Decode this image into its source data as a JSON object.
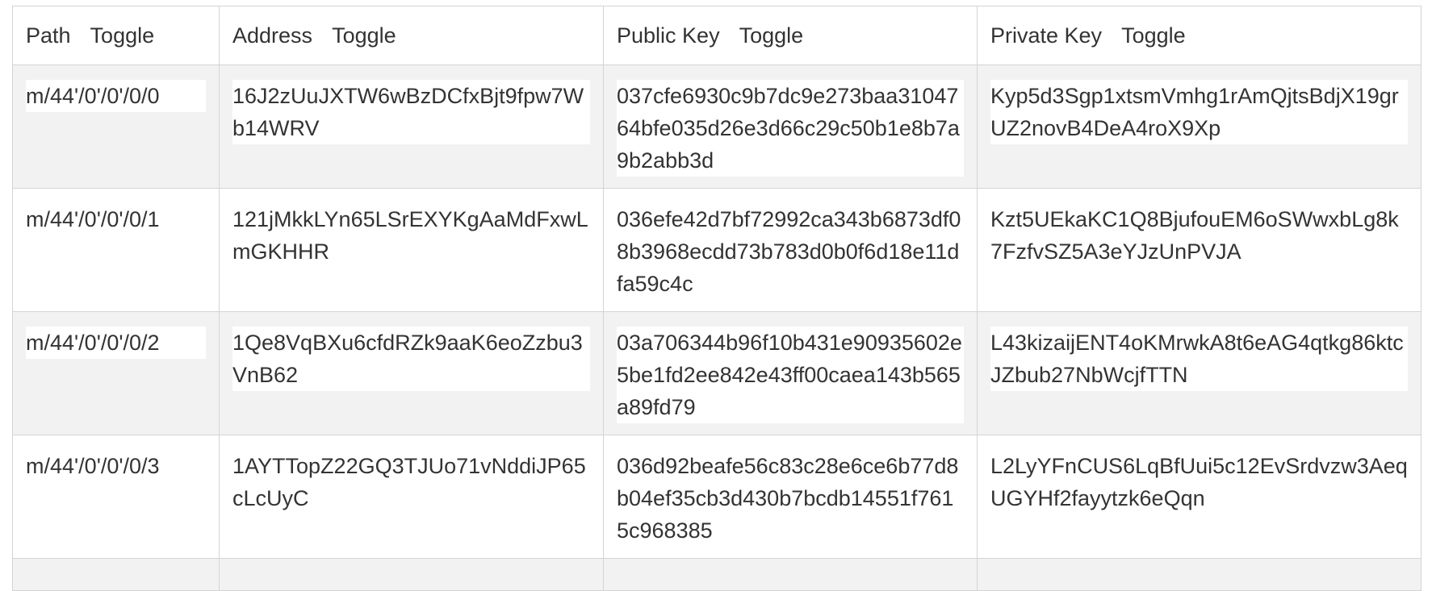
{
  "headers": {
    "path": "Path",
    "address": "Address",
    "public_key": "Public Key",
    "private_key": "Private Key",
    "toggle": "Toggle"
  },
  "rows": [
    {
      "path": "m/44'/0'/0'/0/0",
      "address": "16J2zUuJXTW6wBzDCfxBjt9fpw7Wb14WRV",
      "public_key": "037cfe6930c9b7dc9e273baa3104764bfe035d26e3d66c29c50b1e8b7a9b2abb3d",
      "private_key": "Kyp5d3Sgp1xtsmVmhg1rAmQjtsBdjX19grUZ2novB4DeA4roX9Xp"
    },
    {
      "path": "m/44'/0'/0'/0/1",
      "address": "121jMkkLYn65LSrEXYKgAaMdFxwLmGKHHR",
      "public_key": "036efe42d7bf72992ca343b6873df08b3968ecdd73b783d0b0f6d18e11dfa59c4c",
      "private_key": "Kzt5UEkaKC1Q8BjufouEM6oSWwxbLg8k7FzfvSZ5A3eYJzUnPVJA"
    },
    {
      "path": "m/44'/0'/0'/0/2",
      "address": "1Qe8VqBXu6cfdRZk9aaK6eoZzbu3VnB62",
      "public_key": "03a706344b96f10b431e90935602e5be1fd2ee842e43ff00caea143b565a89fd79",
      "private_key": "L43kizaijENT4oKMrwkA8t6eAG4qtkg86ktcJZbub27NbWcjfTTN"
    },
    {
      "path": "m/44'/0'/0'/0/3",
      "address": "1AYTTopZ22GQ3TJUo71vNddiJP65cLcUyC",
      "public_key": "036d92beafe56c83c28e6ce6b77d8b04ef35cb3d430b7bcdb14551f7615c968385",
      "private_key": "L2LyYFnCUS6LqBfUui5c12EvSrdvzw3AeqUGYHf2fayytzk6eQqn"
    }
  ]
}
